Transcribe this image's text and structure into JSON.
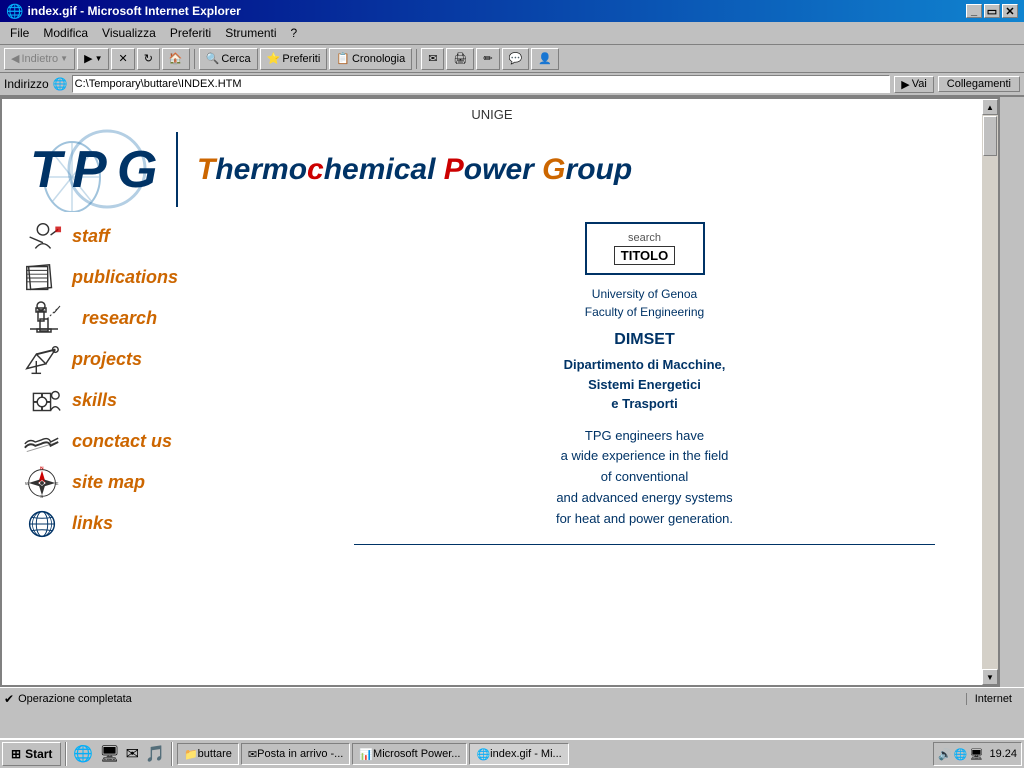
{
  "window": {
    "title": "index.gif - Microsoft Internet Explorer",
    "address": "C:\\Temporary\\buttare\\INDEX.HTM"
  },
  "menubar": {
    "items": [
      "File",
      "Modifica",
      "Visualizza",
      "Preferiti",
      "Strumenti",
      "?"
    ]
  },
  "toolbar": {
    "back": "Indietro",
    "forward": "",
    "stop": "",
    "refresh": "",
    "home": "",
    "search": "Cerca",
    "favorites": "Preferiti",
    "history": "Cronologia",
    "go": "Vai",
    "links": "Collegamenti"
  },
  "address": {
    "label": "Indirizzo",
    "value": "C:\\Temporary\\buttare\\INDEX.HTM"
  },
  "page": {
    "unige": "UNIGE",
    "logo_letters": "TPG",
    "title": "Thermochemical Power Group",
    "title_parts": {
      "T": "T",
      "hermo": "hermo",
      "c": "c",
      "hemical": "hemical",
      "space1": " ",
      "P": "P",
      "ower": "ower",
      "space2": " ",
      "G": "G",
      "roup": "roup"
    },
    "search": {
      "label": "search",
      "title": "TITOLO"
    },
    "university": {
      "name": "University of Genoa",
      "faculty": "Faculty of Engineering"
    },
    "dimset": {
      "title": "DIMSET",
      "dept_line1": "Dipartimento di Macchine,",
      "dept_line2": "Sistemi Energetici",
      "dept_line3": "e Trasporti"
    },
    "description": {
      "line1": "TPG engineers have",
      "line2": "a wide experience in the field",
      "line3": "of conventional",
      "line4": "and advanced energy systems",
      "line5": "for heat and power generation."
    },
    "nav": {
      "staff": "staff",
      "publications": "publications",
      "research": "research",
      "projects": "projects",
      "skills": "skills",
      "contact": "conctact us",
      "sitemap": "site map",
      "links": "links"
    }
  },
  "statusbar": {
    "text": "Operazione completata"
  },
  "taskbar": {
    "start": "Start",
    "time": "19.24",
    "buttons": [
      {
        "label": "buttare",
        "icon": "folder"
      },
      {
        "label": "Posta in arrivo -...",
        "icon": "mail"
      },
      {
        "label": "Microsoft Power...",
        "icon": "powerpoint"
      },
      {
        "label": "index.gif - Mi...",
        "icon": "ie",
        "active": true
      }
    ],
    "tray_label": "Risorse del computer"
  }
}
